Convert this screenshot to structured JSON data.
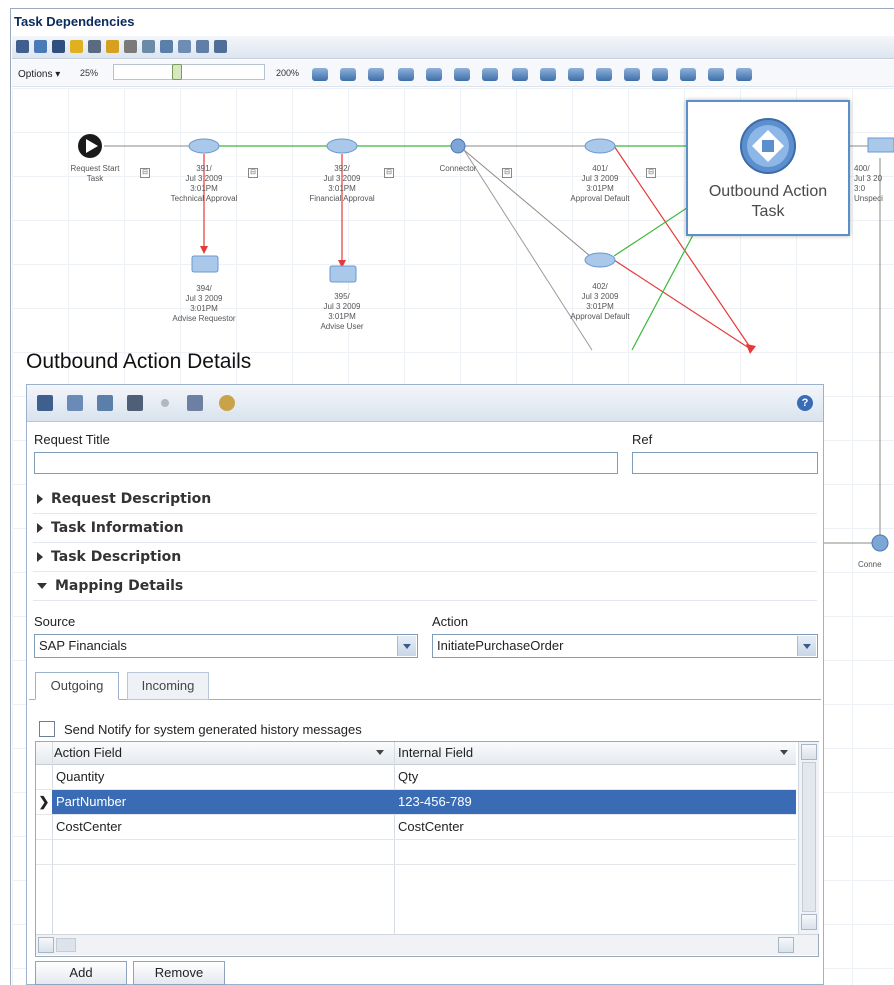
{
  "window": {
    "title": "Task Dependencies"
  },
  "toolbar2": {
    "options_label": "Options",
    "zoom_min": "25%",
    "zoom_max": "200%",
    "zoom_position_fraction": 0.4
  },
  "diagram": {
    "start_node": {
      "label_line1": "Request Start",
      "label_line2": "Task"
    },
    "nodes": [
      {
        "id_line": "391/",
        "date": "Jul 3 2009",
        "time": "3:01PM",
        "name": "Technical Approval"
      },
      {
        "id_line": "392/",
        "date": "Jul 3 2009",
        "time": "3:01PM",
        "name": "Financial Approval"
      },
      {
        "name": "Connector"
      },
      {
        "id_line": "401/",
        "date": "Jul 3 2009",
        "time": "3:01PM",
        "name": "Approval Default"
      },
      {
        "id_line": "394/",
        "date": "Jul 3 2009",
        "time": "3:01PM",
        "name": "Advise Requestor"
      },
      {
        "id_line": "395/",
        "date": "Jul 3 2009",
        "time": "3:01PM",
        "name": "Advise User"
      },
      {
        "id_line": "402/",
        "date": "Jul 3 2009",
        "time": "3:01PM",
        "name": "Approval Default"
      },
      {
        "id_line": "400/",
        "date": "Jul 3 20",
        "time": "3:0",
        "name": "Unspeci"
      },
      {
        "name": "Conne"
      }
    ],
    "callout_label_line1": "Outbound Action",
    "callout_label_line2": "Task"
  },
  "details": {
    "heading": "Outbound Action Details",
    "request_title_label": "Request Title",
    "request_title_value": "",
    "ref_label": "Ref",
    "ref_value": "",
    "sections": [
      "Request Description",
      "Task Information",
      "Task Description",
      "Mapping Details"
    ],
    "source_label": "Source",
    "source_value": "SAP Financials",
    "action_label": "Action",
    "action_value": "InitiatePurchaseOrder",
    "tabs": [
      "Outgoing",
      "Incoming"
    ],
    "notify_label": "Send Notify for system generated history messages",
    "notify_checked": false,
    "table": {
      "columns": [
        "Action Field",
        "Internal Field"
      ],
      "rows": [
        {
          "action": "Quantity",
          "internal": "Qty",
          "selected": false
        },
        {
          "action": "PartNumber",
          "internal": "123-456-789",
          "selected": true
        },
        {
          "action": "CostCenter",
          "internal": "CostCenter",
          "selected": false
        }
      ]
    },
    "add_label": "Add",
    "remove_label": "Remove"
  },
  "colors": {
    "selection": "#3a6cb5",
    "accent": "#5a8fc8",
    "arrow_red": "#e53a3a",
    "arrow_green": "#3cb83c"
  }
}
